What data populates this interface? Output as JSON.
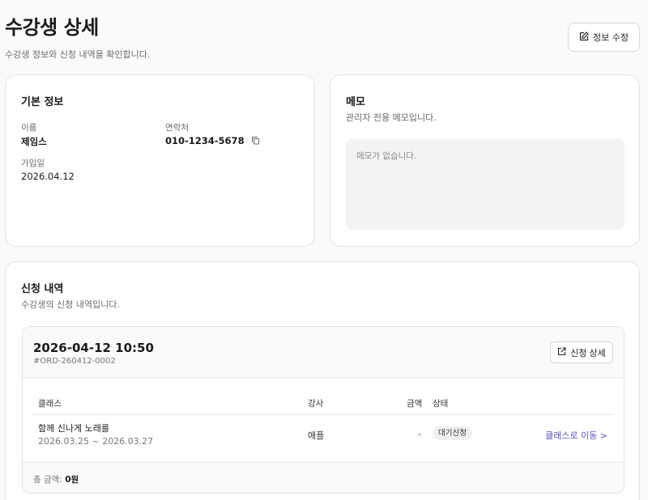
{
  "page": {
    "title": "수강생 상세",
    "subtitle": "수강생 정보와 신청 내역을 확인합니다.",
    "edit_button": "정보 수정"
  },
  "basic": {
    "title": "기본 정보",
    "name_label": "이름",
    "name_value": "제임스",
    "contact_label": "연락처",
    "contact_value": "010-1234-5678",
    "joined_label": "가입일",
    "joined_value": "2026.04.12"
  },
  "memo": {
    "title": "메모",
    "description": "관리자 전용 메모입니다.",
    "placeholder": "메모가 없습니다."
  },
  "history": {
    "title": "신청 내역",
    "description": "수강생의 신청 내역입니다.",
    "orders": [
      {
        "datetime": "2026-04-12 10:50",
        "order_no": "#ORD-260412-0002",
        "detail_button": "신청 상세",
        "columns": {
          "class": "클래스",
          "instructor": "강사",
          "amount": "금액",
          "status": "상태"
        },
        "items": [
          {
            "class_name": "함께 신나게 노래를",
            "period": "2026.03.25 ~ 2026.03.27",
            "instructor": "애플",
            "amount": "-",
            "status": "대기신청",
            "link": "클래스로 이동 >"
          }
        ],
        "total_label": "총 금액:",
        "total_value": "0원"
      }
    ]
  },
  "colors": {
    "link": "#5b54b8",
    "background": "#fafafa",
    "card_border": "#e3e3e3"
  },
  "icons": {
    "edit": "edit-icon",
    "copy": "copy-icon",
    "external": "external-link-icon"
  }
}
